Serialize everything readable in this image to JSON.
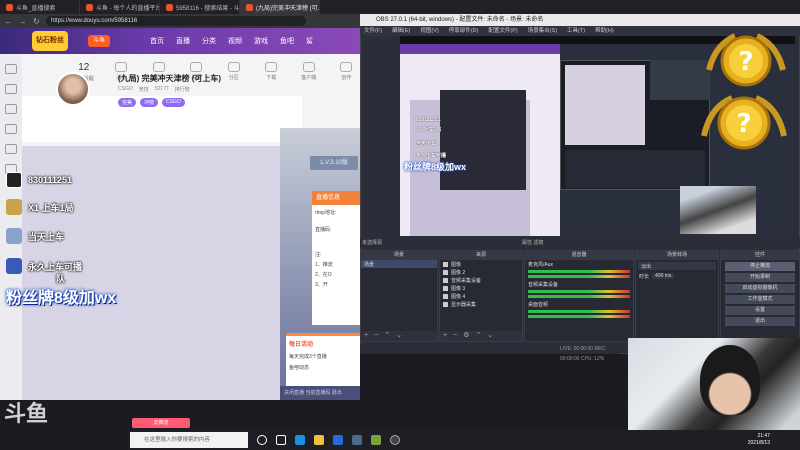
{
  "browser": {
    "tabs": [
      {
        "label": "斗鱼_直播搜索"
      },
      {
        "label": "斗鱼 - 每个人的直播平台"
      },
      {
        "label": "5958116 - 搜索结果 - 斗鱼直播"
      },
      {
        "label": "(九局)完美冲天津榜 (可上车)_CSGO直播_斗鱼直播"
      }
    ],
    "url": "https://www.douyu.com/5958116"
  },
  "site": {
    "nav": [
      "首页",
      "直播",
      "分类",
      "视频",
      "游戏",
      "鱼吧",
      "鲨"
    ],
    "logo_text": "钻石粉丝",
    "logo_text2": "斗鱼",
    "stats": [
      {
        "num": "12",
        "label": "开播提醒"
      },
      {
        "num": "",
        "label": "消息"
      },
      {
        "num": "",
        "label": "历史"
      },
      {
        "num": "",
        "label": "关注"
      },
      {
        "num": "",
        "label": "分区"
      },
      {
        "num": "",
        "label": "下载"
      },
      {
        "num": "",
        "label": "客户端"
      },
      {
        "num": "",
        "label": "创作"
      }
    ],
    "room_title": "(九局) 完美冲天津榜 (可上车)",
    "room_meta": [
      "CSGO",
      "竞技",
      "52177",
      "排行榜"
    ],
    "room_tags": [
      "完美",
      "冲榜",
      "CSGO"
    ],
    "dialog_version": "1.V.3.10版",
    "dialog_head": "直播信息",
    "dialog_lines": [
      "rtmp地址:",
      "直播码:",
      "注:",
      "1、推流",
      "2、在O",
      "3、开"
    ],
    "dialog_bottom": [
      "每日活动",
      "每天完成3个直播",
      "鱼吧动态"
    ],
    "bottom_bar": "关闭直播   当前直播码   退出",
    "pink_btn": "去推流"
  },
  "overlay": {
    "rows": [
      {
        "text": "830111251"
      },
      {
        "text": "X1 上车1局"
      },
      {
        "text": "当天上车"
      },
      {
        "text": "永久上车可播"
      },
      {
        "text": "队"
      }
    ],
    "big": "粉丝牌8级加wx",
    "watermark": "斗鱼"
  },
  "obs": {
    "title": "OBS 27.0.1 (64-bit, windows) - 配置文件: 未命名 - 场景: 未命名",
    "menu": [
      "文件(F)",
      "编辑(E)",
      "视图(V)",
      "停靠部件(D)",
      "配置文件(P)",
      "场景集合(S)",
      "工具(T)",
      "帮助(H)"
    ],
    "preview_overlay": "粉丝牌8级加wx",
    "preview_rows": [
      "830111251",
      "X1 上车1局",
      "当天上车",
      "永久上车可播"
    ],
    "scene_bar_left": "未选择源",
    "scene_bar_mid": "属性   滤镜",
    "docks": {
      "scenes": {
        "title": "场景",
        "items": [
          "场景"
        ]
      },
      "sources": {
        "title": "来源",
        "items": [
          "图像",
          "图像 2",
          "音频采集设备",
          "图像 3",
          "图像 4",
          "显示器采集"
        ]
      },
      "mixer": {
        "title": "混音器",
        "channels": [
          "麦克风/Aux",
          "音频采集设备",
          "桌面音频"
        ]
      },
      "transitions": {
        "title": "场景转场",
        "fade": "淡出",
        "duration_label": "时长",
        "duration": "400 ms"
      },
      "controls": {
        "title": "控件",
        "buttons": [
          "停止推流",
          "开始录制",
          "启动虚拟摄像机",
          "工作室模式",
          "设置",
          "退出"
        ]
      }
    },
    "status": "LIVE: 00:00:00   REC: 00:00:00   CPU: 12%"
  },
  "taskbar": {
    "search_placeholder": "在这里输入你要搜索的内容",
    "time": "21:47",
    "date": "2021/8/13"
  },
  "colors": {
    "accent_purple": "#6a3aa8",
    "douyu_orange": "#ff5d23",
    "overlay_blue": "#2250c8"
  }
}
